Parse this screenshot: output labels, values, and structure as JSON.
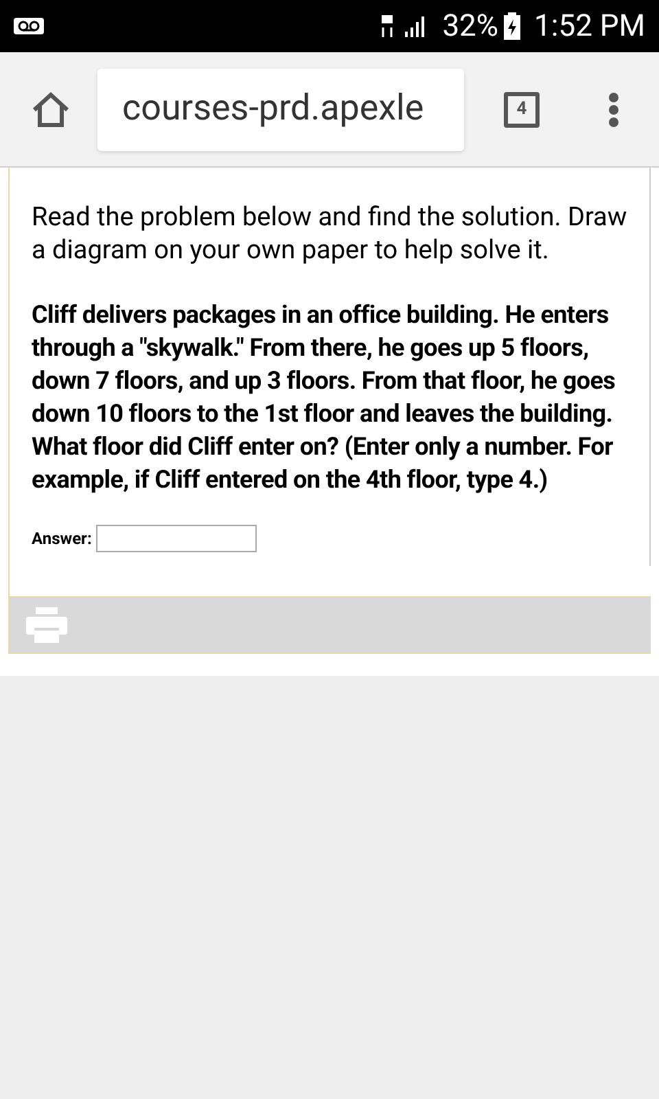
{
  "status_bar": {
    "battery": "32%",
    "time": "1:52 PM"
  },
  "browser": {
    "url": "courses-prd.apexle",
    "tab_count": "4"
  },
  "instructions": "Read the problem below and find the solution. Draw a diagram on your own paper to help solve it.",
  "problem": "Cliff delivers packages in an office building. He enters through a \"skywalk.\" From there, he goes up 5 floors, down 7 floors, and up 3 floors. From that floor, he goes down 10 floors to the 1st floor and leaves the building. What floor did Cliff enter on? (Enter only a number. For example, if Cliff entered on the 4th floor, type 4.)",
  "answer": {
    "label": "Answer:"
  }
}
